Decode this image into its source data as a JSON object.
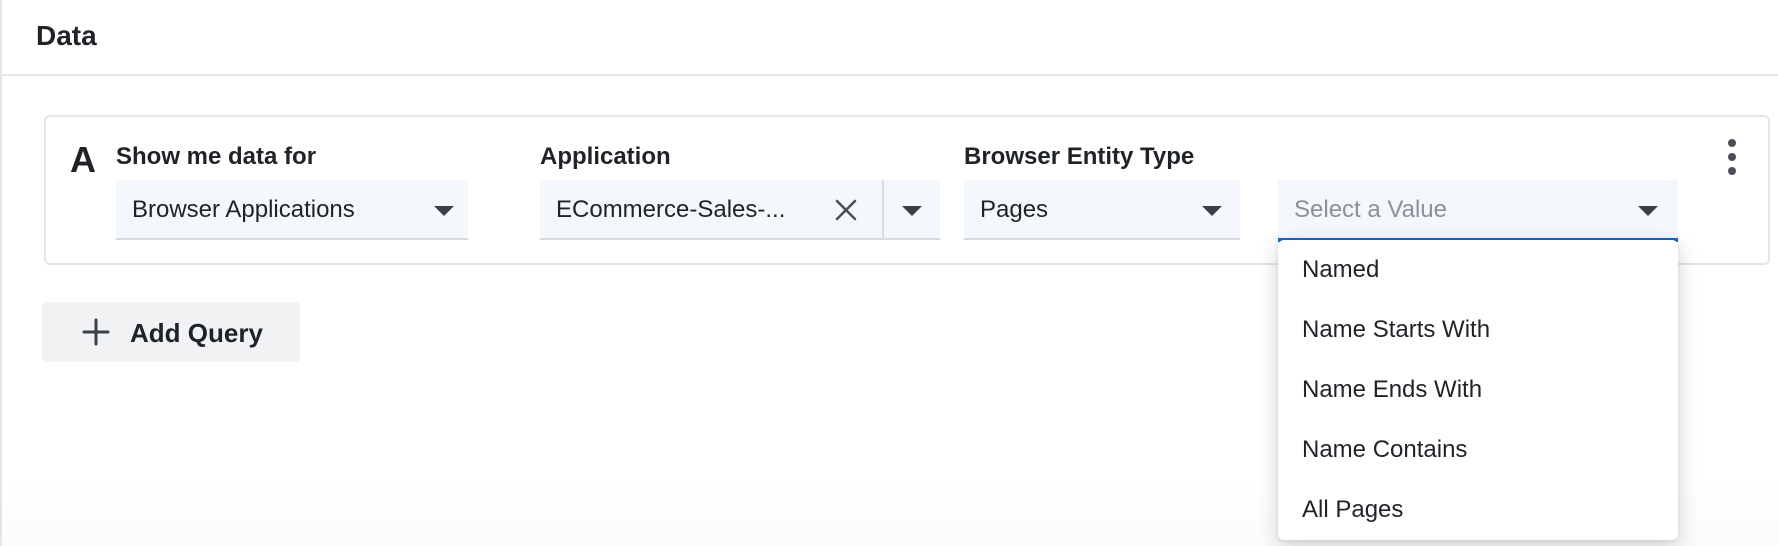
{
  "section": {
    "title": "Data"
  },
  "query": {
    "letter": "A",
    "show_me": {
      "label": "Show me data for",
      "value": "Browser Applications"
    },
    "application": {
      "label": "Application",
      "value": "ECommerce-Sales-..."
    },
    "entity_type": {
      "label": "Browser Entity Type",
      "value": "Pages"
    },
    "filter": {
      "placeholder": "Select a Value"
    }
  },
  "add_query": {
    "label": "Add Query"
  },
  "menu": {
    "items": [
      {
        "label": "Named"
      },
      {
        "label": "Name Starts With"
      },
      {
        "label": "Name Ends With"
      },
      {
        "label": "Name Contains"
      },
      {
        "label": "All Pages"
      }
    ]
  },
  "colors": {
    "focus_accent": "#1767c9",
    "field_bg": "#f4f8fc"
  },
  "icons": [
    "clear-icon",
    "chevron-down-icon",
    "kebab-menu-icon",
    "plus-icon"
  ]
}
